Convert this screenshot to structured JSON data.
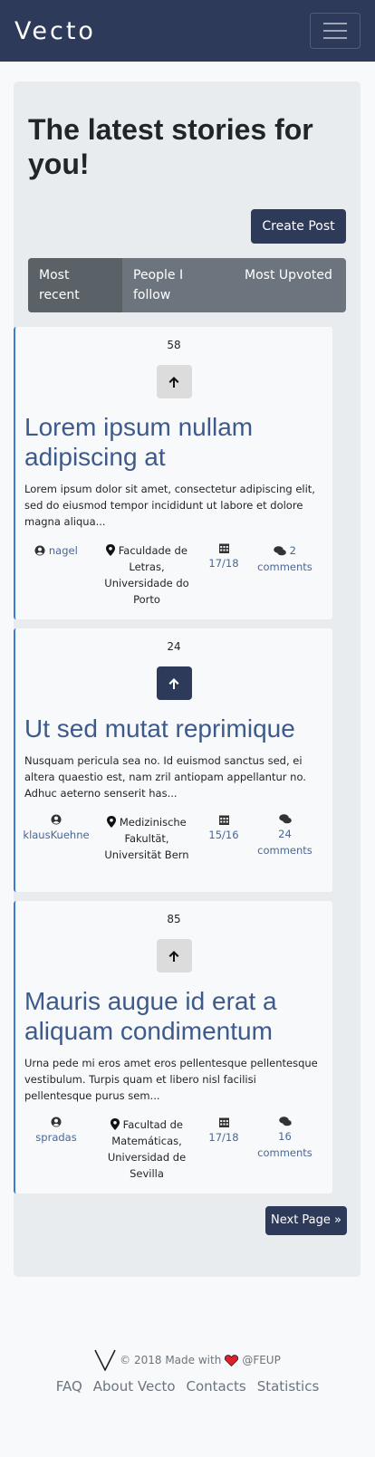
{
  "nav": {
    "brand": "Vecto"
  },
  "main": {
    "heading": "The latest stories for you!",
    "create_label": "Create Post",
    "tabs": [
      "Most recent",
      "People I follow",
      "Most Upvoted"
    ],
    "next_label": "Next Page »"
  },
  "posts": [
    {
      "votes": "58",
      "title": "Lorem ipsum nullam adipiscing at",
      "excerpt": "Lorem ipsum dolor sit amet, consectetur adipiscing elit, sed do eiusmod tempor incididunt ut labore et dolore magna aliqua...",
      "author": "nagel",
      "location": "Faculdade de Letras, Universidade do Porto",
      "date": "17/18",
      "comments": "2 comments"
    },
    {
      "votes": "24",
      "title": "Ut sed mutat reprimique",
      "excerpt": "Nusquam pericula sea no. Id euismod sanctus sed, ei altera quaestio est, nam zril antiopam appellantur no. Adhuc aeterno senserit has...",
      "author": "klausKuehne",
      "location": "Medizinische Fakultät, Universität Bern",
      "date": "15/16",
      "comments": "24 comments"
    },
    {
      "votes": "85",
      "title": "Mauris augue id erat a aliquam condimentum",
      "excerpt": "Urna pede mi eros amet eros pellentesque pellentesque vestibulum. Turpis quam et libero nisl facilisi pellentesque purus sem...",
      "author": "spradas",
      "location": "Facultad de Matemáticas, Universidad de Sevilla",
      "date": "17/18",
      "comments": "16 comments"
    }
  ],
  "footer": {
    "copyright": "© 2018 Made with",
    "org": "@FEUP",
    "links": [
      "FAQ",
      "About Vecto",
      "Contacts",
      "Statistics"
    ]
  },
  "colors": {
    "nav_bg": "#2e3a59",
    "accent": "#3a7bd5",
    "title": "#3e5a8a",
    "heart": "#e0202a"
  }
}
